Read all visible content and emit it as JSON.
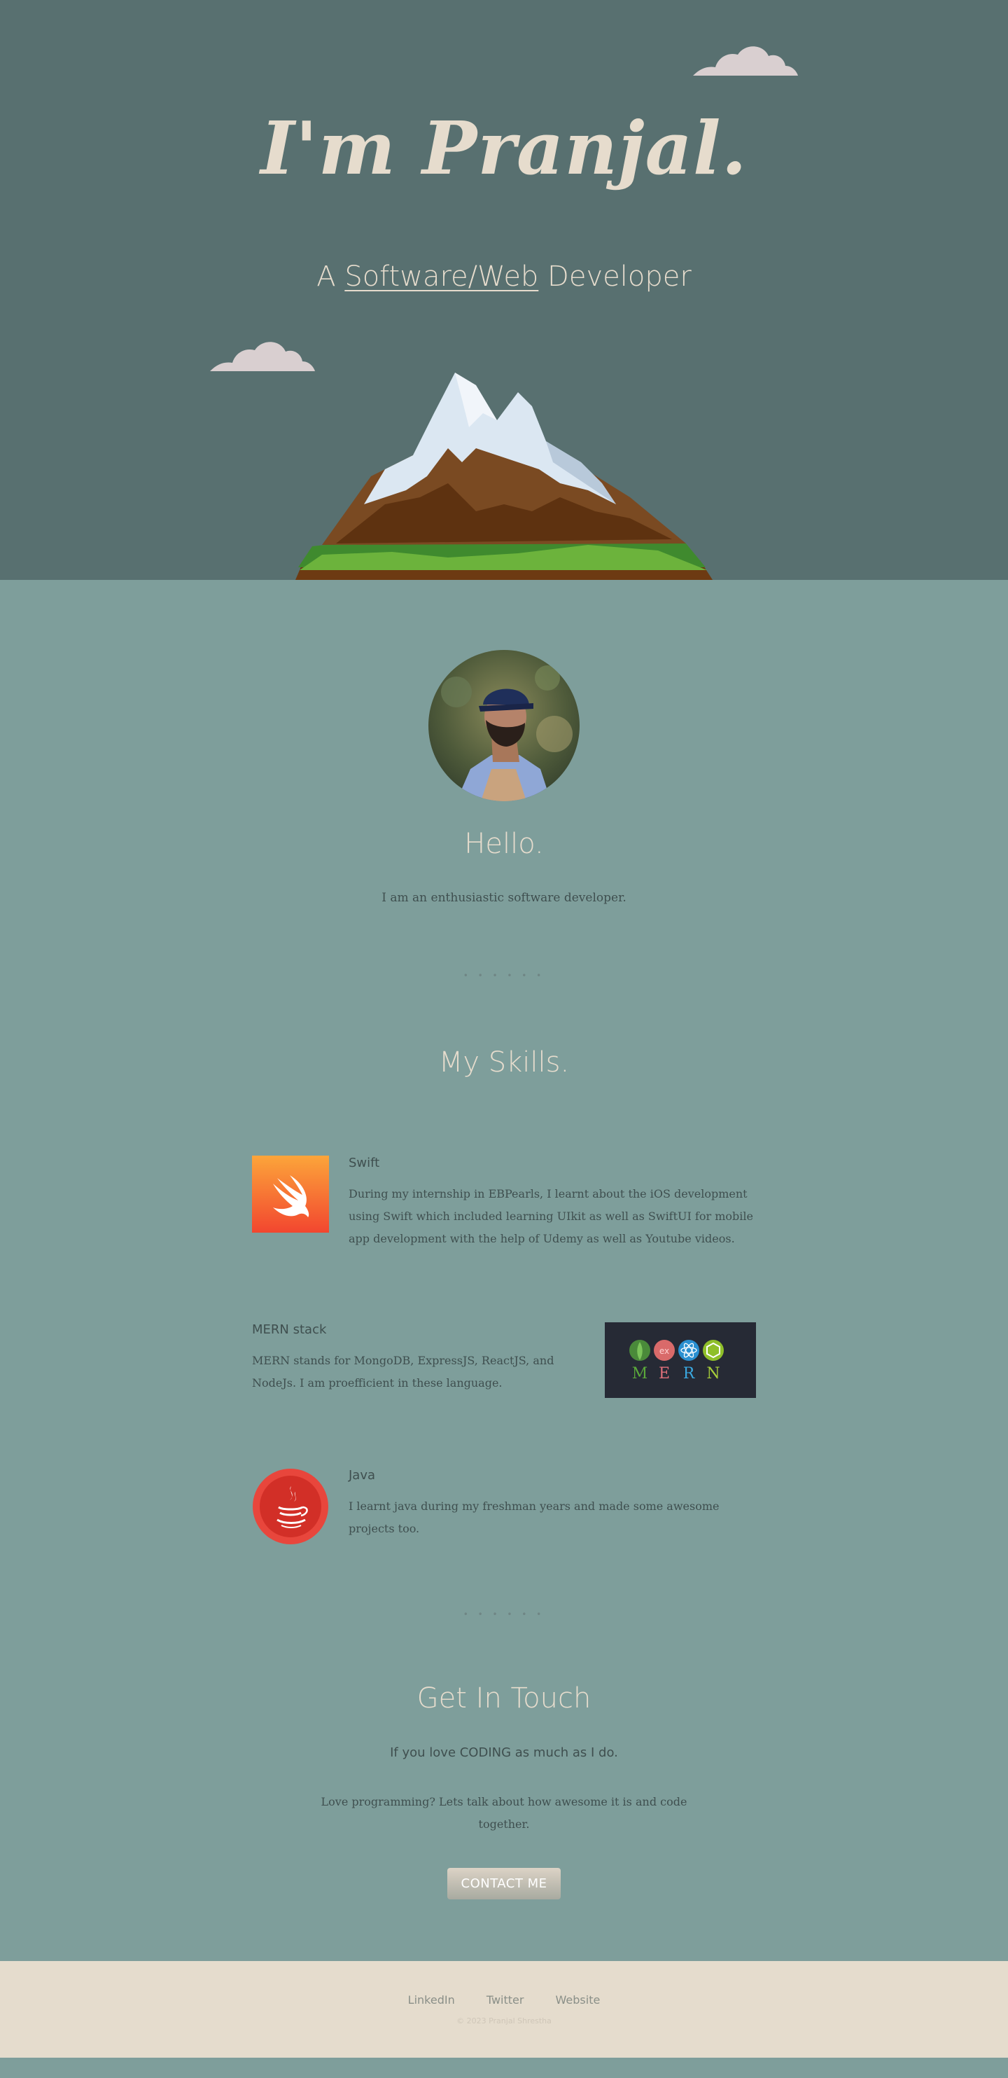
{
  "hero": {
    "title": "I'm Pranjal.",
    "subtitle_prefix": "A ",
    "subtitle_link": "Software/Web",
    "subtitle_suffix": " Developer"
  },
  "about": {
    "greeting": "Hello.",
    "text": "I am an enthusiastic software developer."
  },
  "divider": "• • • • • •",
  "skills": {
    "title": "My Skills.",
    "items": [
      {
        "name": "Swift",
        "description": "During my internship in EBPearls, I learnt about the iOS development using Swift which included learning UIkit as well as SwiftUI for mobile app development with the help of Udemy as well as Youtube videos.",
        "icon": "swift-icon"
      },
      {
        "name": "MERN stack",
        "description": "MERN stands for MongoDB, ExpressJS, ReactJS, and NodeJs. I am proefficient in these language.",
        "icon": "mern-icon",
        "logo_letters": [
          "M",
          "E",
          "R",
          "N"
        ],
        "logo_badge": "ex"
      },
      {
        "name": "Java",
        "description": "I learnt java during my freshman years and made some awesome projects too.",
        "icon": "java-icon"
      }
    ]
  },
  "contact": {
    "title": "Get In Touch",
    "lead": "If you love CODING as much as I do.",
    "text": "Love programming? Lets talk about how awesome it is and code together.",
    "button": "CONTACT ME"
  },
  "footer": {
    "links": [
      "LinkedIn",
      "Twitter",
      "Website"
    ],
    "copyright": "© 2023 Pranjal Shrestha"
  },
  "colors": {
    "hero_bg": "#587070",
    "body_bg": "#7e9e9b",
    "accent_text": "#e6dccd",
    "footer_bg": "#e5dccd"
  }
}
